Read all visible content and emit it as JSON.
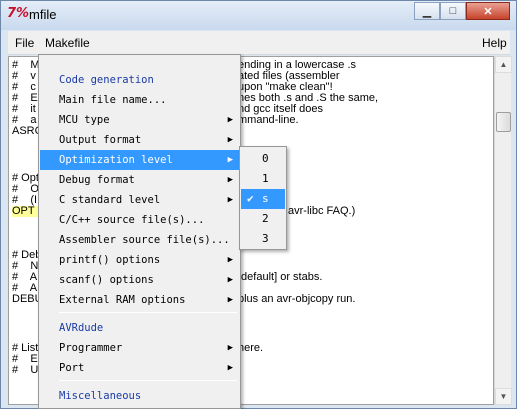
{
  "window": {
    "title": "mfile",
    "app_icon": "tk-feather-icon"
  },
  "menubar": {
    "file": "File",
    "makefile": "Makefile",
    "help": "Help"
  },
  "editor_lines": [
    "#    M",
    "#    v",
    "#    c",
    "#    E",
    "#    it",
    "#    a",
    "ASRC",
    "",
    "",
    "# Opt",
    "#    O",
    "#    (I",
    "OPT =",
    "",
    "",
    "",
    "# Deb",
    "#    N",
    "#    A",
    "#    A",
    "DEBU",
    "",
    "",
    "",
    "",
    "# List",
    "#    E",
    "#    U"
  ],
  "editor_right_text": [
    "ending in a lowercase .s",
    "ated files (assembler",
    "upon \"make clean\"!",
    "nes both .s and .S the same,",
    "nd gcc itself does",
    "mmand-line.",
    "avr-libc FAQ.)",
    "[default] or stabs.",
    "plus an avr-objcopy run.",
    "here."
  ],
  "makefile_menu": {
    "items": [
      {
        "label": "Code generation",
        "type": "header"
      },
      {
        "label": "Main file name...",
        "type": "item"
      },
      {
        "label": "MCU type",
        "type": "submenu"
      },
      {
        "label": "Output format",
        "type": "submenu"
      },
      {
        "label": "Optimization level",
        "type": "submenu",
        "active": true
      },
      {
        "label": "Debug format",
        "type": "submenu"
      },
      {
        "label": "C standard level",
        "type": "submenu"
      },
      {
        "label": "C/C++ source file(s)...",
        "type": "item"
      },
      {
        "label": "Assembler source file(s)...",
        "type": "item"
      },
      {
        "label": "printf() options",
        "type": "submenu"
      },
      {
        "label": "scanf() options",
        "type": "submenu"
      },
      {
        "label": "External RAM options",
        "type": "submenu"
      },
      {
        "label": "AVRdude",
        "type": "header"
      },
      {
        "label": "Programmer",
        "type": "submenu"
      },
      {
        "label": "Port",
        "type": "submenu"
      },
      {
        "label": "Miscellaneous",
        "type": "header"
      }
    ]
  },
  "optimization_submenu": {
    "items": [
      {
        "label": "0",
        "checked": false
      },
      {
        "label": "1",
        "checked": false
      },
      {
        "label": "s",
        "checked": true
      },
      {
        "label": "2",
        "checked": false
      },
      {
        "label": "3",
        "checked": false
      }
    ],
    "check_glyph": "✔"
  },
  "icons": {
    "minimize": "minimize-icon",
    "maximize": "maximize-icon",
    "close": "close-icon",
    "submenu_arrow": "▶",
    "scroll_up": "▲",
    "scroll_down": "▼"
  }
}
